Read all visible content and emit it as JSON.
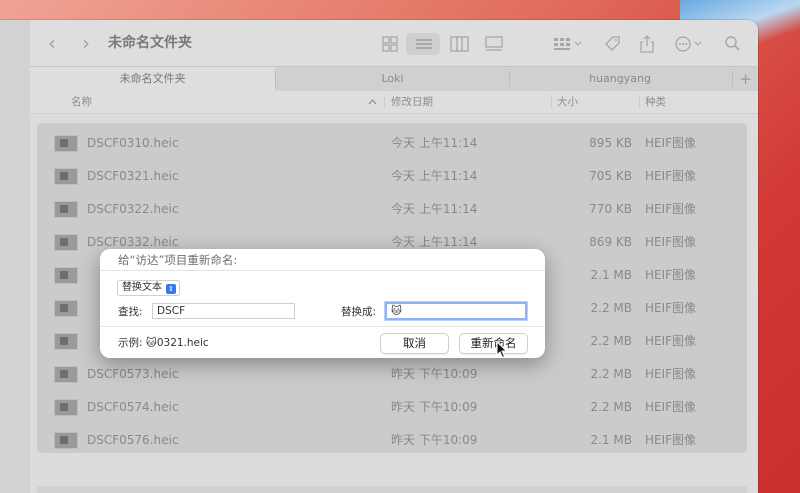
{
  "toolbar": {
    "back": "‹",
    "forward": "›",
    "title": "未命名文件夹"
  },
  "tabs": [
    {
      "label": "未命名文件夹",
      "active": true
    },
    {
      "label": "Loki",
      "active": false
    },
    {
      "label": "huangyang",
      "active": false
    }
  ],
  "new_tab": "+",
  "columns": {
    "name": "名称",
    "date": "修改日期",
    "size": "大小",
    "kind": "种类"
  },
  "files": [
    {
      "name": "DSCF0310.heic",
      "date": "今天 上午11:14",
      "size": "895 KB",
      "kind": "HEIF图像"
    },
    {
      "name": "DSCF0321.heic",
      "date": "今天 上午11:14",
      "size": "705 KB",
      "kind": "HEIF图像"
    },
    {
      "name": "DSCF0322.heic",
      "date": "今天 上午11:14",
      "size": "770 KB",
      "kind": "HEIF图像"
    },
    {
      "name": "DSCF0332.heic",
      "date": "今天 上午11:14",
      "size": "869 KB",
      "kind": "HEIF图像"
    },
    {
      "name": "",
      "date": "",
      "size": "2.1 MB",
      "kind": "HEIF图像"
    },
    {
      "name": "",
      "date": "",
      "size": "2.2 MB",
      "kind": "HEIF图像"
    },
    {
      "name": "",
      "date": "",
      "size": "2.2 MB",
      "kind": "HEIF图像"
    },
    {
      "name": "DSCF0573.heic",
      "date": "昨天 下午10:09",
      "size": "2.2 MB",
      "kind": "HEIF图像"
    },
    {
      "name": "DSCF0574.heic",
      "date": "昨天 下午10:09",
      "size": "2.2 MB",
      "kind": "HEIF图像"
    },
    {
      "name": "DSCF0576.heic",
      "date": "昨天 下午10:09",
      "size": "2.1 MB",
      "kind": "HEIF图像"
    }
  ],
  "dialog": {
    "title": "给“访达”项目重新命名:",
    "mode": "替换文本",
    "find_label": "查找:",
    "find_value": "DSCF",
    "replace_label": "替换成:",
    "replace_value": "🐱",
    "example_label": "示例:",
    "example_value": "🐱0321.heic",
    "cancel": "取消",
    "rename": "重新命名"
  },
  "colors": {
    "accent": "#3478f6",
    "wallpaper": "#d23a36"
  }
}
